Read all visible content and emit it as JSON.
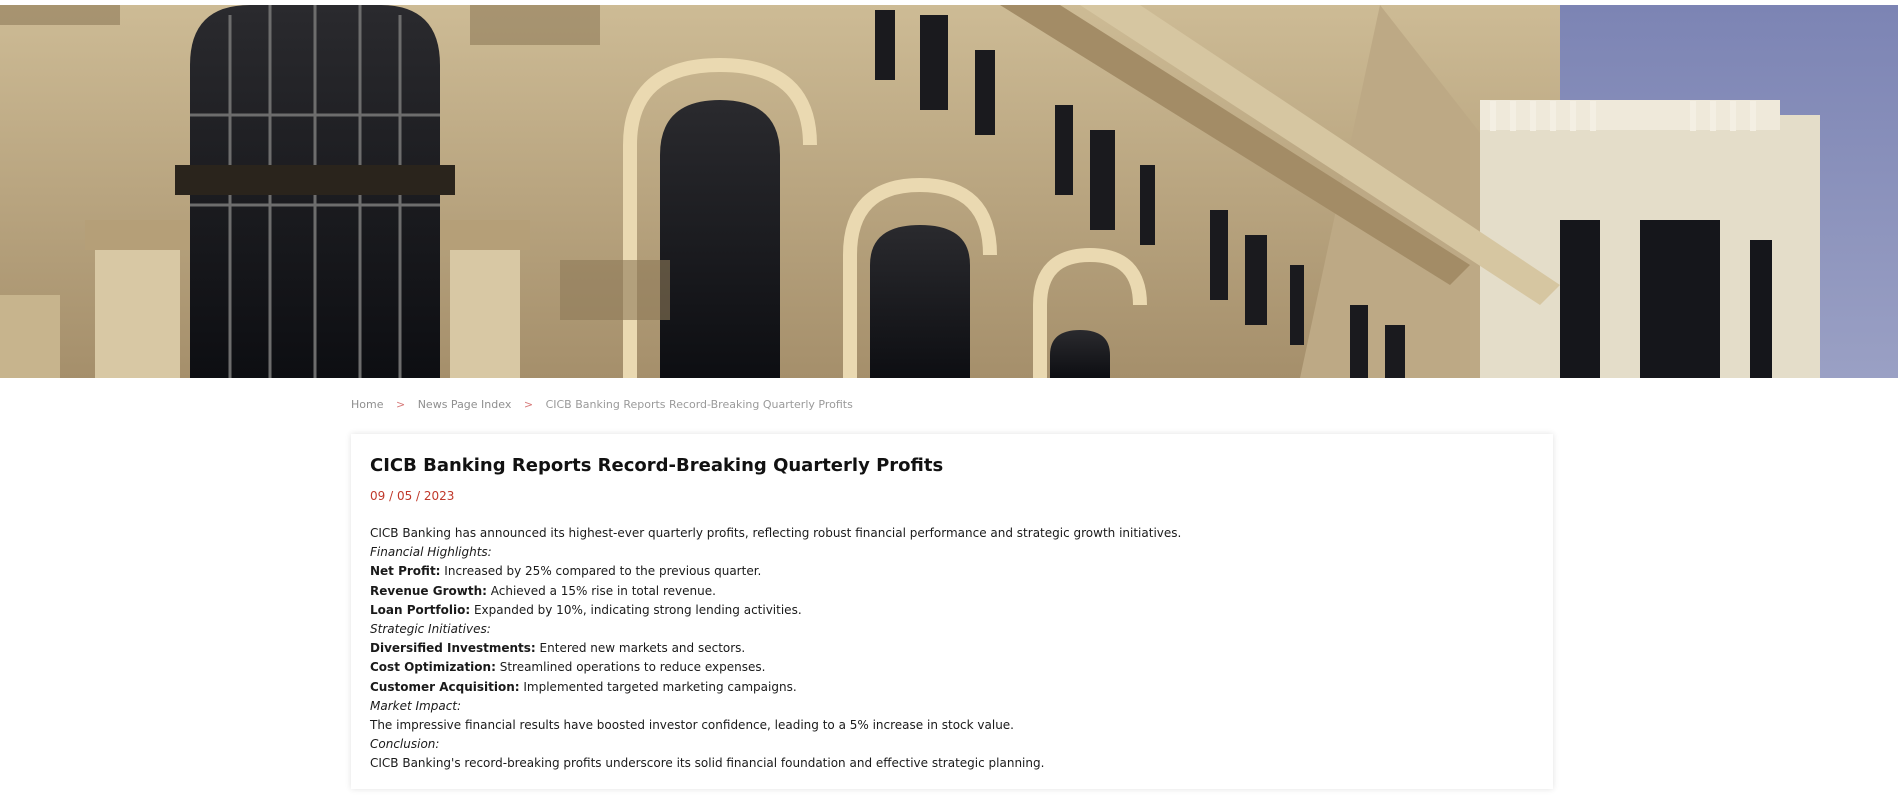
{
  "hero": {
    "image_name": "building-facade-hero"
  },
  "breadcrumb": {
    "items": [
      "Home",
      "News Page Index",
      "CICB Banking Reports Record-Breaking Quarterly Profits"
    ],
    "separator": ">"
  },
  "article": {
    "title": "CICB Banking Reports Record-Breaking Quarterly Profits",
    "date": "09 / 05 / 2023",
    "intro": "CICB Banking has announced its highest-ever quarterly profits, reflecting robust financial performance and strategic growth initiatives.",
    "sections": [
      {
        "heading": "Financial Highlights:",
        "items": [
          {
            "label": "Net Profit:",
            "text": " Increased by 25% compared to the previous quarter."
          },
          {
            "label": "Revenue Growth:",
            "text": " Achieved a 15% rise in total revenue."
          },
          {
            "label": "Loan Portfolio:",
            "text": " Expanded by 10%, indicating strong lending activities."
          }
        ]
      },
      {
        "heading": "Strategic Initiatives:",
        "items": [
          {
            "label": "Diversified Investments:",
            "text": " Entered new markets and sectors."
          },
          {
            "label": "Cost Optimization:",
            "text": " Streamlined operations to reduce expenses."
          },
          {
            "label": "Customer Acquisition:",
            "text": " Implemented targeted marketing campaigns."
          }
        ]
      }
    ],
    "market_heading": "Market Impact:",
    "market_text": "The impressive financial results have boosted investor confidence, leading to a 5% increase in stock value.",
    "conclusion_heading": "Conclusion:",
    "conclusion_text": "CICB Banking's record-breaking profits underscore its solid financial foundation and effective strategic planning."
  },
  "colors": {
    "date": "#c0392b",
    "breadcrumb_separator": "#d77a7a",
    "breadcrumb_text": "#8f8f8f",
    "title": "#111111"
  }
}
